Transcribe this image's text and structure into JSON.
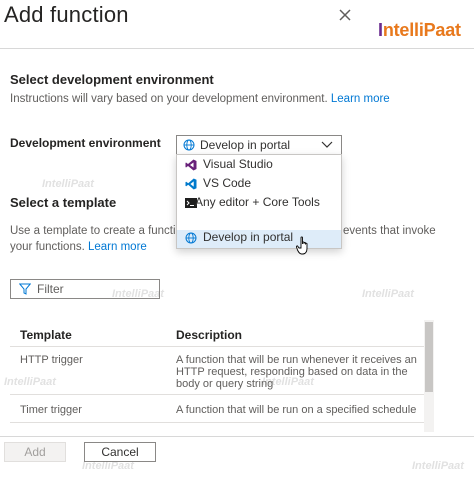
{
  "header": {
    "title": "Add function",
    "brand": {
      "text_prefix": "I",
      "text_rest": "ntelliPaat",
      "color": "#e8791d",
      "accent": "#6a2c8f"
    }
  },
  "env_section": {
    "title": "Select development environment",
    "description": "Instructions will vary based on your development environment.",
    "learn_more": "Learn more",
    "field_label": "Development environment",
    "selected_value": "Develop in portal",
    "options": [
      {
        "label": "Visual Studio",
        "icon": "visual-studio-icon"
      },
      {
        "label": "VS Code",
        "icon": "vscode-icon"
      },
      {
        "label": "Any editor + Core Tools",
        "icon": "terminal-icon"
      },
      {
        "label": "Develop in portal",
        "icon": "globe-icon"
      }
    ]
  },
  "template_section": {
    "title": "Select a template",
    "description_line1_left": "Use a template to create a functi",
    "description_line1_right": "events that invoke",
    "description_line2": "your functions.",
    "learn_more": "Learn more",
    "filter_placeholder": "Filter"
  },
  "table": {
    "headers": {
      "template": "Template",
      "description": "Description"
    },
    "rows": [
      {
        "template": "HTTP trigger",
        "description": "A function that will be run whenever it receives an HTTP request, responding based on data in the body or query string"
      },
      {
        "template": "Timer trigger",
        "description": "A function that will be run on a specified schedule"
      }
    ]
  },
  "footer": {
    "add_label": "Add",
    "cancel_label": "Cancel"
  },
  "watermark": "IntelliPaat",
  "colors": {
    "link": "#0078d4",
    "selected_bg": "#deecf9"
  }
}
